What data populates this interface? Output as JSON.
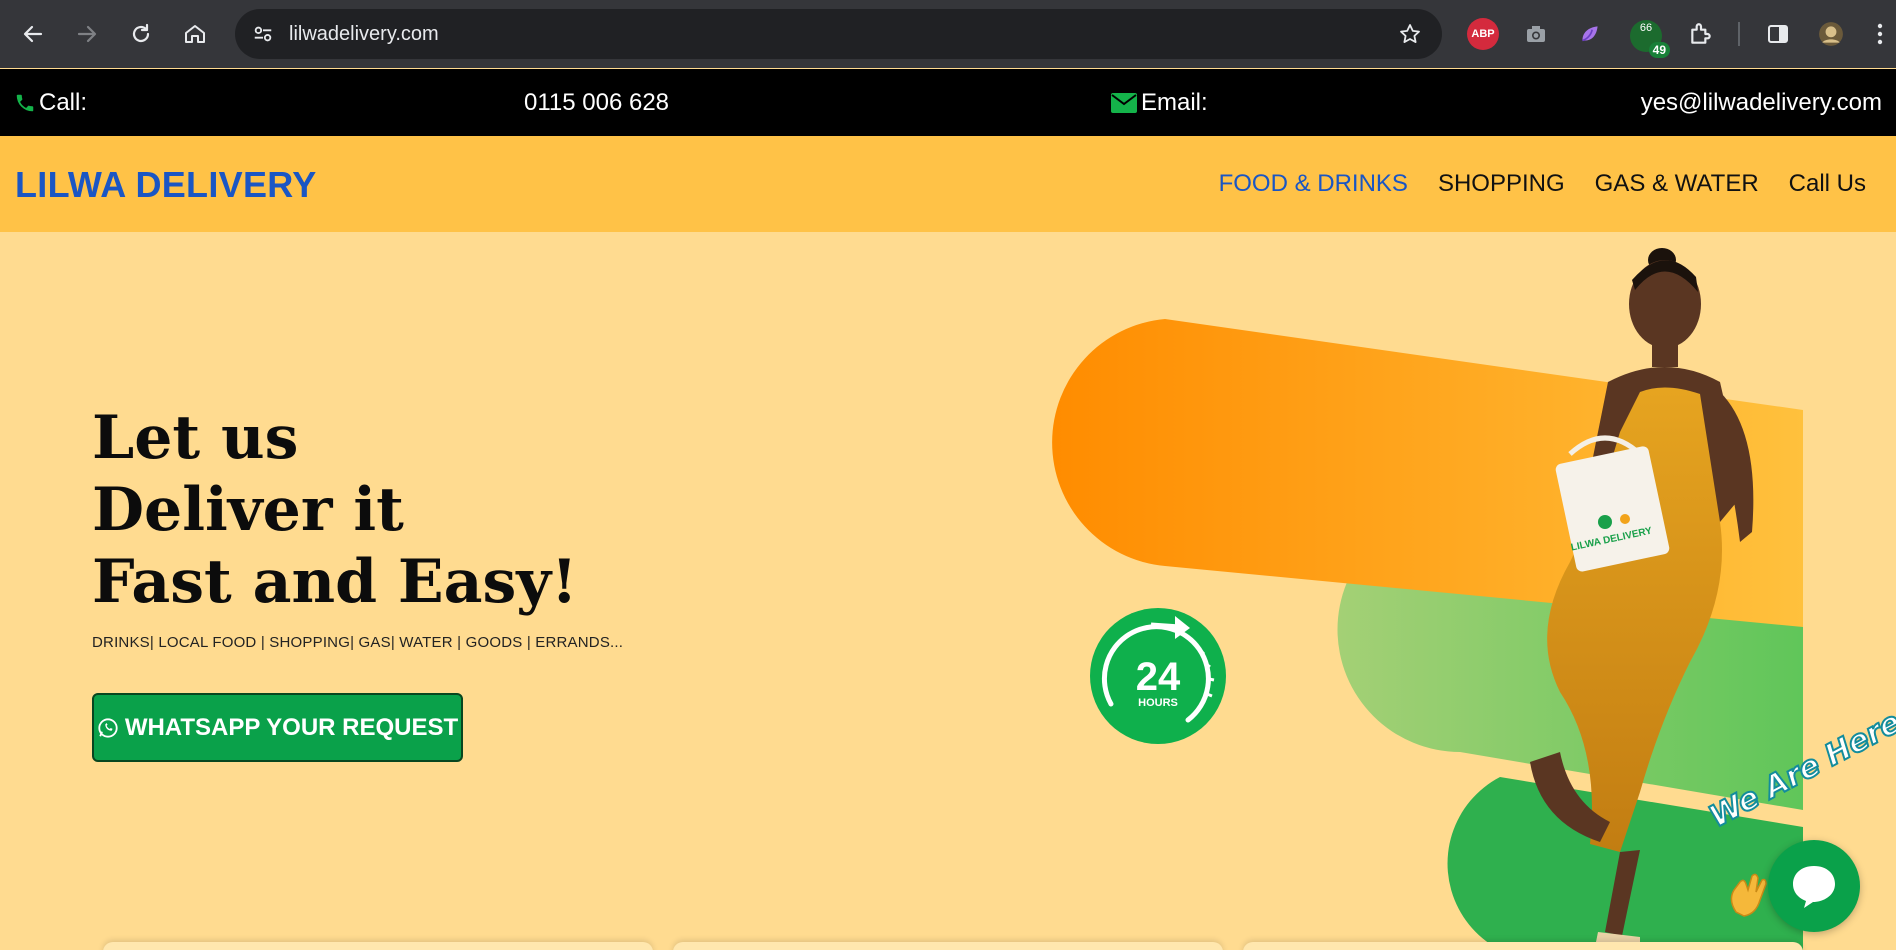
{
  "browser": {
    "url": "lilwadelivery.com",
    "abp_label": "ABP",
    "badge_top": "66",
    "badge_bottom": "49"
  },
  "contact": {
    "call_label": "Call:",
    "phone": "0115 006 628",
    "email_label": "Email:",
    "email": "yes@lilwadelivery.com"
  },
  "header": {
    "logo": "LILWA DELIVERY",
    "menu": [
      {
        "label": "FOOD & DRINKS"
      },
      {
        "label": "SHOPPING"
      },
      {
        "label": "GAS & WATER"
      },
      {
        "label": "Call Us"
      }
    ]
  },
  "hero": {
    "headline_1": "Let us",
    "headline_2": "Deliver it",
    "headline_3": "Fast and Easy!",
    "tagline": "DRINKS| LOCAL FOOD | SHOPPING| GAS| WATER | GOODS | ERRANDS...",
    "cta": "WHATSAPP YOUR REQUEST",
    "badge_number": "24",
    "badge_unit": "HOURS",
    "bag_brand": "LILWA DELIVERY"
  },
  "chat": {
    "invite": "We Are Here!"
  },
  "colors": {
    "header_bg": "#ffc247",
    "hero_bg": "#ffdb90",
    "brand_blue": "#1a56c4",
    "whatsapp_green": "#0aa14a",
    "strip_bg": "#000000"
  }
}
